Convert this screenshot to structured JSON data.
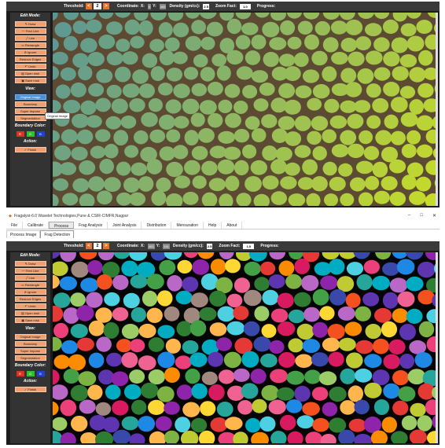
{
  "toolbar": {
    "threshold_label": "Threshold:",
    "threshold_dec": "<",
    "threshold_value": "2",
    "threshold_inc": ">",
    "coordinate_label": "Coordinate:",
    "x_prefix": "X:",
    "y_prefix": "Y:",
    "top_x": "0",
    "top_y": "405",
    "bot_x": "403",
    "bot_y": "331",
    "density_label": "Density (gm/cc):",
    "density_value": "2.5",
    "zoom_label": "Zoom Fact:",
    "zoom_value": "1.0",
    "progress_label": "Progress:"
  },
  "sidebar": {
    "edit_mode_title": "Edit Mode:",
    "edit_buttons": [
      "Draw",
      "Free Line",
      "Line",
      "Rectangle",
      "Ignore",
      "Remove Edges",
      "Undo",
      "Open msk",
      "Save msk"
    ],
    "view_title": "View:",
    "view_buttons": [
      "Original Image",
      "Boundary",
      "Super Impose",
      "Segmentation"
    ],
    "boundary_color_title": "Boundary Color:",
    "boundary_colors": [
      {
        "label": "R",
        "color": "#e03020"
      },
      {
        "label": "G",
        "color": "#30c030"
      },
      {
        "label": "B",
        "color": "#2040d0"
      }
    ],
    "action_title": "Action:",
    "finish_label": "Finish"
  },
  "tooltip": "Original Image",
  "window": {
    "title": "Fragalyst-6.0  Wavelet Technologies,Pune  &  CSIR-CIMFR,Nagpur",
    "controls": [
      "–",
      "□",
      "✕"
    ]
  },
  "menu": [
    "File",
    "Calibrate",
    "Process",
    "Frag Analysis",
    "Joint Analysis",
    "Distribution",
    "Mensuration",
    "Help",
    "About"
  ],
  "active_menu": "Process",
  "subtabs": [
    "Process Image",
    "Frag Detection"
  ],
  "active_subtab": "Frag Detection",
  "colors": {
    "accent": "#e8722a",
    "button": "#f0a070",
    "selected": "#4a90d9",
    "panel": "#333333",
    "frame": "#1c1c1c"
  }
}
